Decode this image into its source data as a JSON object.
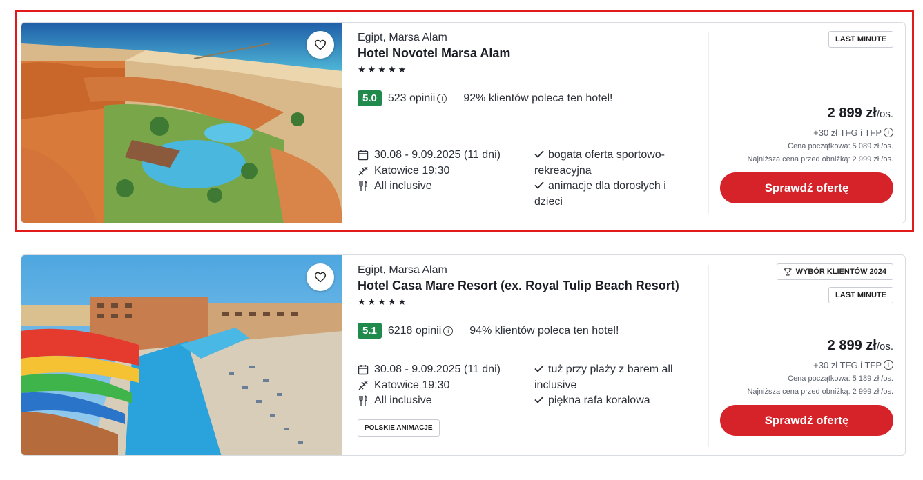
{
  "offers": [
    {
      "location": "Egipt, Marsa Alam",
      "name": "Hotel Novotel Marsa Alam",
      "stars": "★★★★★",
      "score": "5.0",
      "reviews": "523 opinii",
      "recommend": "92% klientów poleca ten hotel!",
      "dates": "30.08 - 9.09.2025 (11 dni)",
      "departure": "Katowice 19:30",
      "board": "All inclusive",
      "features": [
        "bogata oferta sportowo-rekreacyjna",
        "animacje dla dorosłych i dzieci"
      ],
      "badges": [
        "LAST MINUTE"
      ],
      "price_amount": "2 899 zł",
      "price_per": "/os.",
      "tfg": "+30 zł TFG i TFP",
      "base_price": "Cena początkowa: 5 089 zł /os.",
      "lowest_price": "Najniższa cena przed obniżką: 2 999 zł /os.",
      "cta": "Sprawdź ofertę"
    },
    {
      "location": "Egipt, Marsa Alam",
      "name": "Hotel Casa Mare Resort (ex. Royal Tulip Beach Resort)",
      "stars": "★★★★★",
      "score": "5.1",
      "reviews": "6218 opinii",
      "recommend": "94% klientów poleca ten hotel!",
      "dates": "30.08 - 9.09.2025 (11 dni)",
      "departure": "Katowice 19:30",
      "board": "All inclusive",
      "features": [
        "tuż przy plaży z barem all inclusive",
        "piękna rafa koralowa"
      ],
      "tag": "POLSKIE ANIMACJE",
      "badges": [
        "WYBÓR KLIENTÓW 2024",
        "LAST MINUTE"
      ],
      "price_amount": "2 899 zł",
      "price_per": "/os.",
      "tfg": "+30 zł TFG i TFP",
      "base_price": "Cena początkowa: 5 189 zł /os.",
      "lowest_price": "Najniższa cena przed obniżką: 2 999 zł /os.",
      "cta": "Sprawdź ofertę"
    }
  ],
  "icons": {
    "favorite": "heart-icon",
    "calendar": "calendar-icon",
    "plane": "plane-icon",
    "food": "fork-knife-icon",
    "check": "check-icon",
    "info": "info-icon",
    "trophy": "trophy-icon"
  },
  "colors": {
    "score_bg": "#1f8a4c",
    "cta_bg": "#d6232a",
    "highlight": "#e11b1b"
  }
}
